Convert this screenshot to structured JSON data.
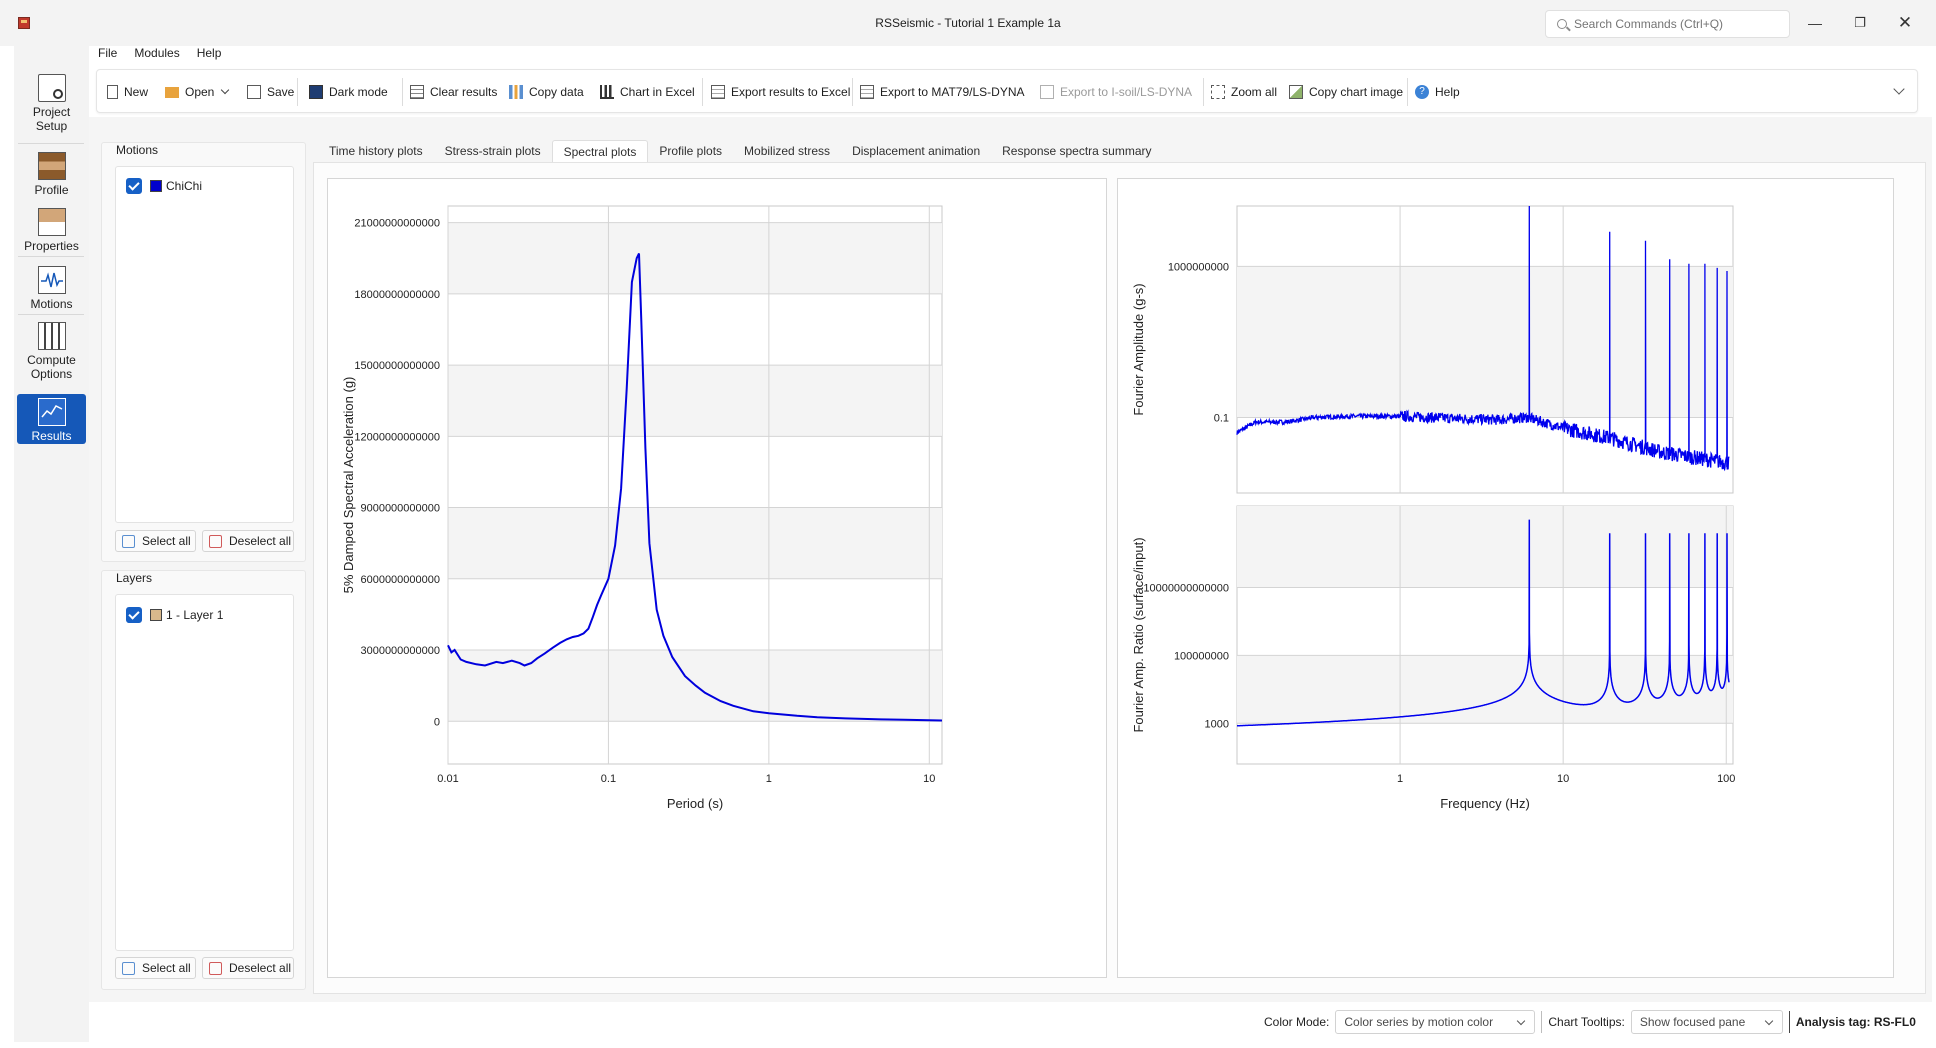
{
  "window": {
    "title": "RSSeismic - Tutorial 1 Example 1a",
    "search_placeholder": "Search Commands (Ctrl+Q)"
  },
  "rail": {
    "items": [
      {
        "label": "Project Setup",
        "icon": "project-setup-icon",
        "active": false
      },
      {
        "label": "Profile",
        "icon": "profile-icon",
        "active": false
      },
      {
        "label": "Properties",
        "icon": "properties-icon",
        "active": false
      },
      {
        "label": "Motions",
        "icon": "motions-icon",
        "active": false
      },
      {
        "label": "Compute Options",
        "icon": "compute-options-icon",
        "active": false
      },
      {
        "label": "Results",
        "icon": "results-icon",
        "active": true
      }
    ]
  },
  "menu": {
    "file": "File",
    "modules": "Modules",
    "help": "Help"
  },
  "toolbar": {
    "new": "New",
    "open": "Open",
    "save": "Save",
    "dark_mode": "Dark mode",
    "clear_results": "Clear results",
    "copy_data": "Copy data",
    "chart_in_excel": "Chart in Excel",
    "export_results_excel": "Export results to Excel",
    "export_mat79": "Export to MAT79/LS-DYNA",
    "export_isoil": "Export to I-soil/LS-DYNA",
    "zoom_all": "Zoom all",
    "copy_chart_image": "Copy chart image",
    "help": "Help"
  },
  "motions": {
    "title": "Motions",
    "items": [
      {
        "label": "ChiChi",
        "color": "#0000cc",
        "checked": true
      }
    ],
    "select_all": "Select all",
    "deselect_all": "Deselect all"
  },
  "layers": {
    "title": "Layers",
    "items": [
      {
        "label": "1 - Layer 1",
        "color": "#d9b98c",
        "checked": true
      }
    ],
    "select_all": "Select all",
    "deselect_all": "Deselect all"
  },
  "tabs": [
    {
      "label": "Time history plots",
      "active": false
    },
    {
      "label": "Stress-strain plots",
      "active": false
    },
    {
      "label": "Spectral plots",
      "active": true
    },
    {
      "label": "Profile plots",
      "active": false
    },
    {
      "label": "Mobilized stress",
      "active": false
    },
    {
      "label": "Displacement animation",
      "active": false
    },
    {
      "label": "Response spectra summary",
      "active": false
    }
  ],
  "statusbar": {
    "color_mode_label": "Color Mode:",
    "color_mode_value": "Color series by motion color",
    "chart_tooltips_label": "Chart Tooltips:",
    "chart_tooltips_value": "Show focused pane",
    "analysis_tag": "Analysis tag: RS-FL0"
  },
  "chart_data": [
    {
      "type": "line",
      "xscale": "log",
      "xlabel": "Period (s)",
      "ylabel": "5% Damped Spectral Acceleration (g)",
      "xlim": [
        0.01,
        12
      ],
      "ylim": [
        -1800000000000,
        21700000000000
      ],
      "xticks": [
        {
          "v": 0.01,
          "label": "0.01"
        },
        {
          "v": 0.1,
          "label": "0.1"
        },
        {
          "v": 1,
          "label": "1"
        },
        {
          "v": 10,
          "label": "10"
        }
      ],
      "yticks": [
        {
          "v": 0,
          "label": "0"
        },
        {
          "v": 3000000000000,
          "label": "3000000000000"
        },
        {
          "v": 6000000000000,
          "label": "6000000000000"
        },
        {
          "v": 9000000000000,
          "label": "9000000000000"
        },
        {
          "v": 12000000000000,
          "label": "12000000000000"
        },
        {
          "v": 15000000000000,
          "label": "15000000000000"
        },
        {
          "v": 18000000000000,
          "label": "18000000000000"
        },
        {
          "v": 21000000000000,
          "label": "21000000000000"
        }
      ],
      "series": [
        {
          "color": "#0000dd",
          "x": [
            0.01,
            0.0105,
            0.011,
            0.012,
            0.013,
            0.015,
            0.017,
            0.02,
            0.022,
            0.025,
            0.028,
            0.03,
            0.033,
            0.036,
            0.04,
            0.045,
            0.05,
            0.055,
            0.06,
            0.065,
            0.07,
            0.075,
            0.08,
            0.085,
            0.09,
            0.1,
            0.11,
            0.12,
            0.13,
            0.14,
            0.15,
            0.155,
            0.16,
            0.17,
            0.18,
            0.2,
            0.22,
            0.25,
            0.3,
            0.35,
            0.4,
            0.5,
            0.6,
            0.8,
            1,
            1.5,
            2,
            3,
            5,
            7,
            10,
            12
          ],
          "y": [
            3200000000000,
            2900000000000,
            3000000000000,
            2600000000000,
            2500000000000,
            2400000000000,
            2350000000000,
            2500000000000,
            2450000000000,
            2550000000000,
            2450000000000,
            2350000000000,
            2450000000000,
            2650000000000,
            2850000000000,
            3100000000000,
            3300000000000,
            3450000000000,
            3550000000000,
            3600000000000,
            3700000000000,
            3900000000000,
            4400000000000,
            4900000000000,
            5300000000000,
            6000000000000,
            7400000000000,
            9800000000000,
            14000000000000,
            18500000000000,
            19500000000000,
            19700000000000,
            17000000000000,
            11500000000000,
            7500000000000,
            4700000000000,
            3600000000000,
            2700000000000,
            1900000000000,
            1500000000000,
            1200000000000,
            850000000000,
            650000000000,
            420000000000,
            340000000000,
            230000000000,
            170000000000,
            120000000000,
            80000000000,
            60000000000,
            40000000000,
            30000000000
          ]
        }
      ]
    },
    {
      "type": "line",
      "xscale": "log",
      "yscale": "log",
      "xlabel": "",
      "ylabel": "Fourier Amplitude (g-s)",
      "xlim": [
        0.1,
        110
      ],
      "ylim": [
        1e-06,
        10000000000000
      ],
      "xticks": [
        {
          "v": 1
        },
        {
          "v": 10
        }
      ],
      "yticks": [
        {
          "v": 0.1,
          "label": "0.1"
        },
        {
          "v": 1000000000,
          "label": "1000000000"
        }
      ],
      "series": [
        {
          "color": "#0000ee",
          "baseline": [
            [
              0.1,
              0.01
            ],
            [
              0.13,
              0.05
            ],
            [
              0.2,
              0.05
            ],
            [
              0.3,
              0.1
            ],
            [
              0.5,
              0.12
            ],
            [
              1,
              0.12
            ],
            [
              2,
              0.09
            ],
            [
              4,
              0.07
            ],
            [
              6,
              0.1
            ],
            [
              10,
              0.02
            ],
            [
              20,
              0.004
            ],
            [
              40,
              0.0005
            ],
            [
              100,
              0.0001
            ]
          ],
          "peaks": [
            [
              6.2,
              10000000000000
            ],
            [
              19.3,
              200000000000
            ],
            [
              32,
              50000000000
            ],
            [
              45,
              3000000000
            ],
            [
              59,
              1500000000
            ],
            [
              74,
              1500000000
            ],
            [
              88,
              800000000
            ],
            [
              101,
              500000000
            ]
          ]
        }
      ]
    },
    {
      "type": "line",
      "xscale": "log",
      "yscale": "log",
      "xlabel": "Frequency (Hz)",
      "ylabel": "Fourier Amp. Ratio (surface/input)",
      "xlim": [
        0.1,
        110
      ],
      "ylim": [
        1,
        10000000000000000000
      ],
      "xticks": [
        {
          "v": 1,
          "label": "1"
        },
        {
          "v": 10,
          "label": "10"
        },
        {
          "v": 100,
          "label": "100"
        }
      ],
      "yticks": [
        {
          "v": 1000,
          "label": "1000"
        },
        {
          "v": 100000000,
          "label": "100000000"
        },
        {
          "v": 10000000000000,
          "label": "10000000000000"
        }
      ],
      "series": [
        {
          "color": "#0000ee",
          "baseline_value": 1.1,
          "peaks": [
            [
              6.2,
              1000000000000000000
            ],
            [
              19.3,
              100000000000000000
            ],
            [
              32,
              100000000000000000
            ],
            [
              45,
              100000000000000000
            ],
            [
              59,
              100000000000000000
            ],
            [
              74,
              100000000000000000
            ],
            [
              88,
              100000000000000000
            ],
            [
              101,
              100000000000000000
            ]
          ]
        }
      ]
    }
  ]
}
